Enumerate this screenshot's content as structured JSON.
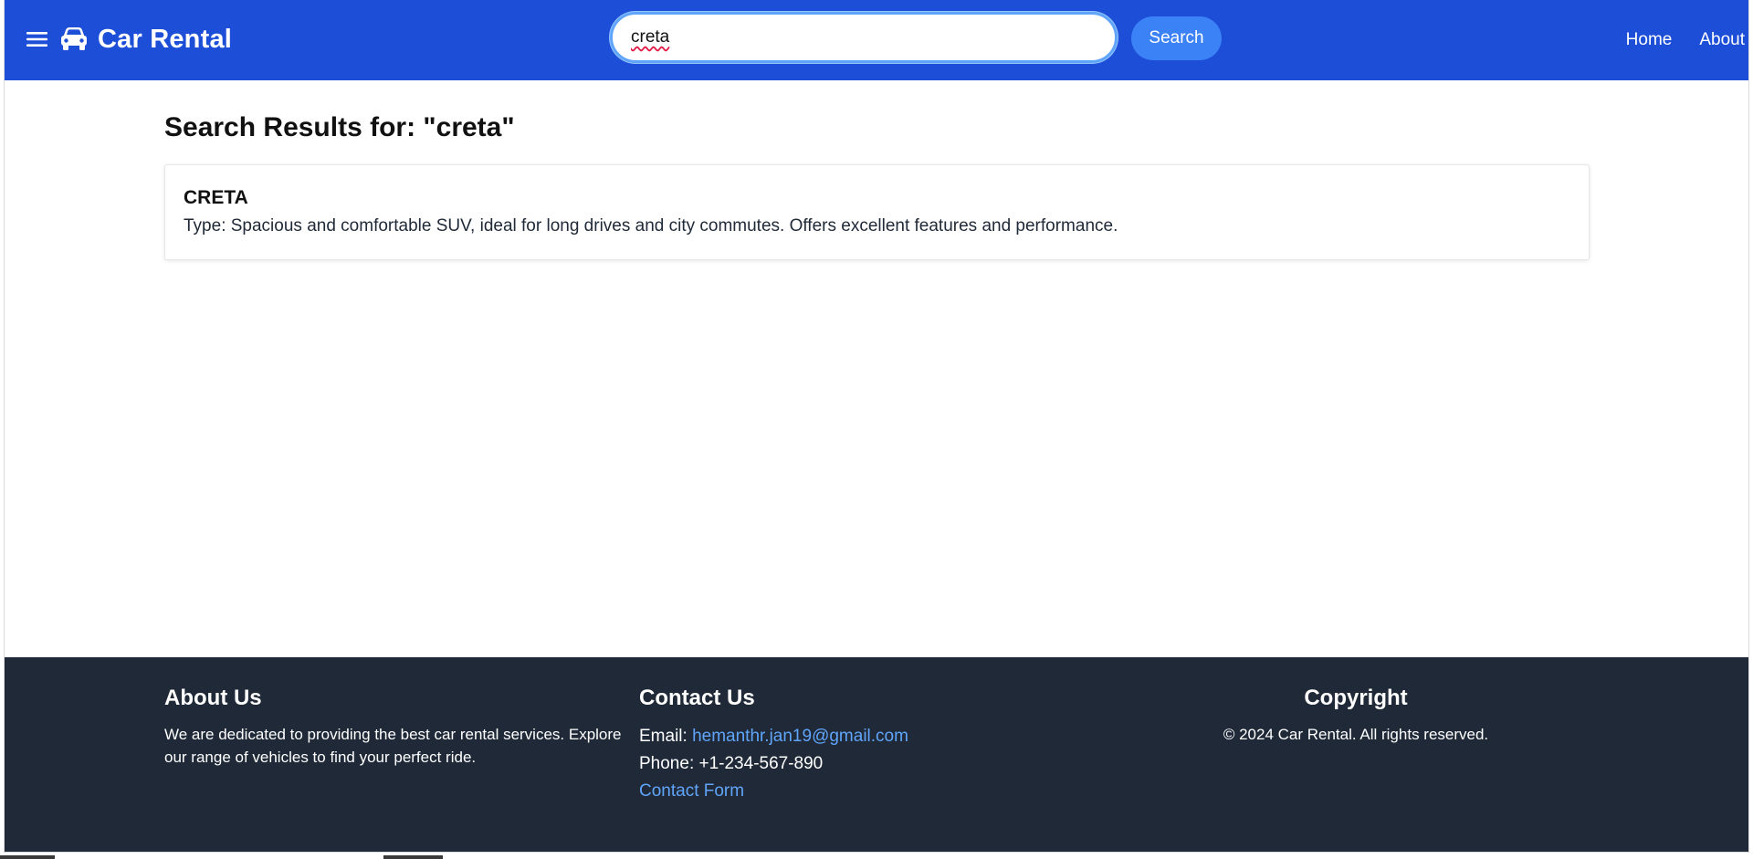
{
  "header": {
    "brand_name": "Car Rental",
    "menu_icon": "hamburger-menu-icon",
    "brand_icon": "car-icon",
    "search": {
      "value": "creta",
      "button_label": "Search"
    },
    "nav": [
      "Home",
      "About"
    ]
  },
  "results": {
    "title": "Search Results for: \"creta\"",
    "items": [
      {
        "name": "CRETA",
        "description": "Type: Spacious and comfortable SUV, ideal for long drives and city commutes. Offers excellent features and performance."
      }
    ]
  },
  "footer": {
    "about": {
      "title": "About Us",
      "text": "We are dedicated to providing the best car rental services. Explore our range of vehicles to find your perfect ride."
    },
    "contact": {
      "title": "Contact Us",
      "email_label": "Email:",
      "email": "hemanthr.jan19@gmail.com",
      "phone": "Phone: +1-234-567-890",
      "form_link": "Contact Form"
    },
    "copyright": {
      "title": "Copyright",
      "text": "© 2024 Car Rental. All rights reserved."
    }
  },
  "colors": {
    "header_bg": "#1d4ed8",
    "button_bg": "#3b82f6",
    "footer_bg": "#1f2937",
    "link": "#60a5fa"
  }
}
